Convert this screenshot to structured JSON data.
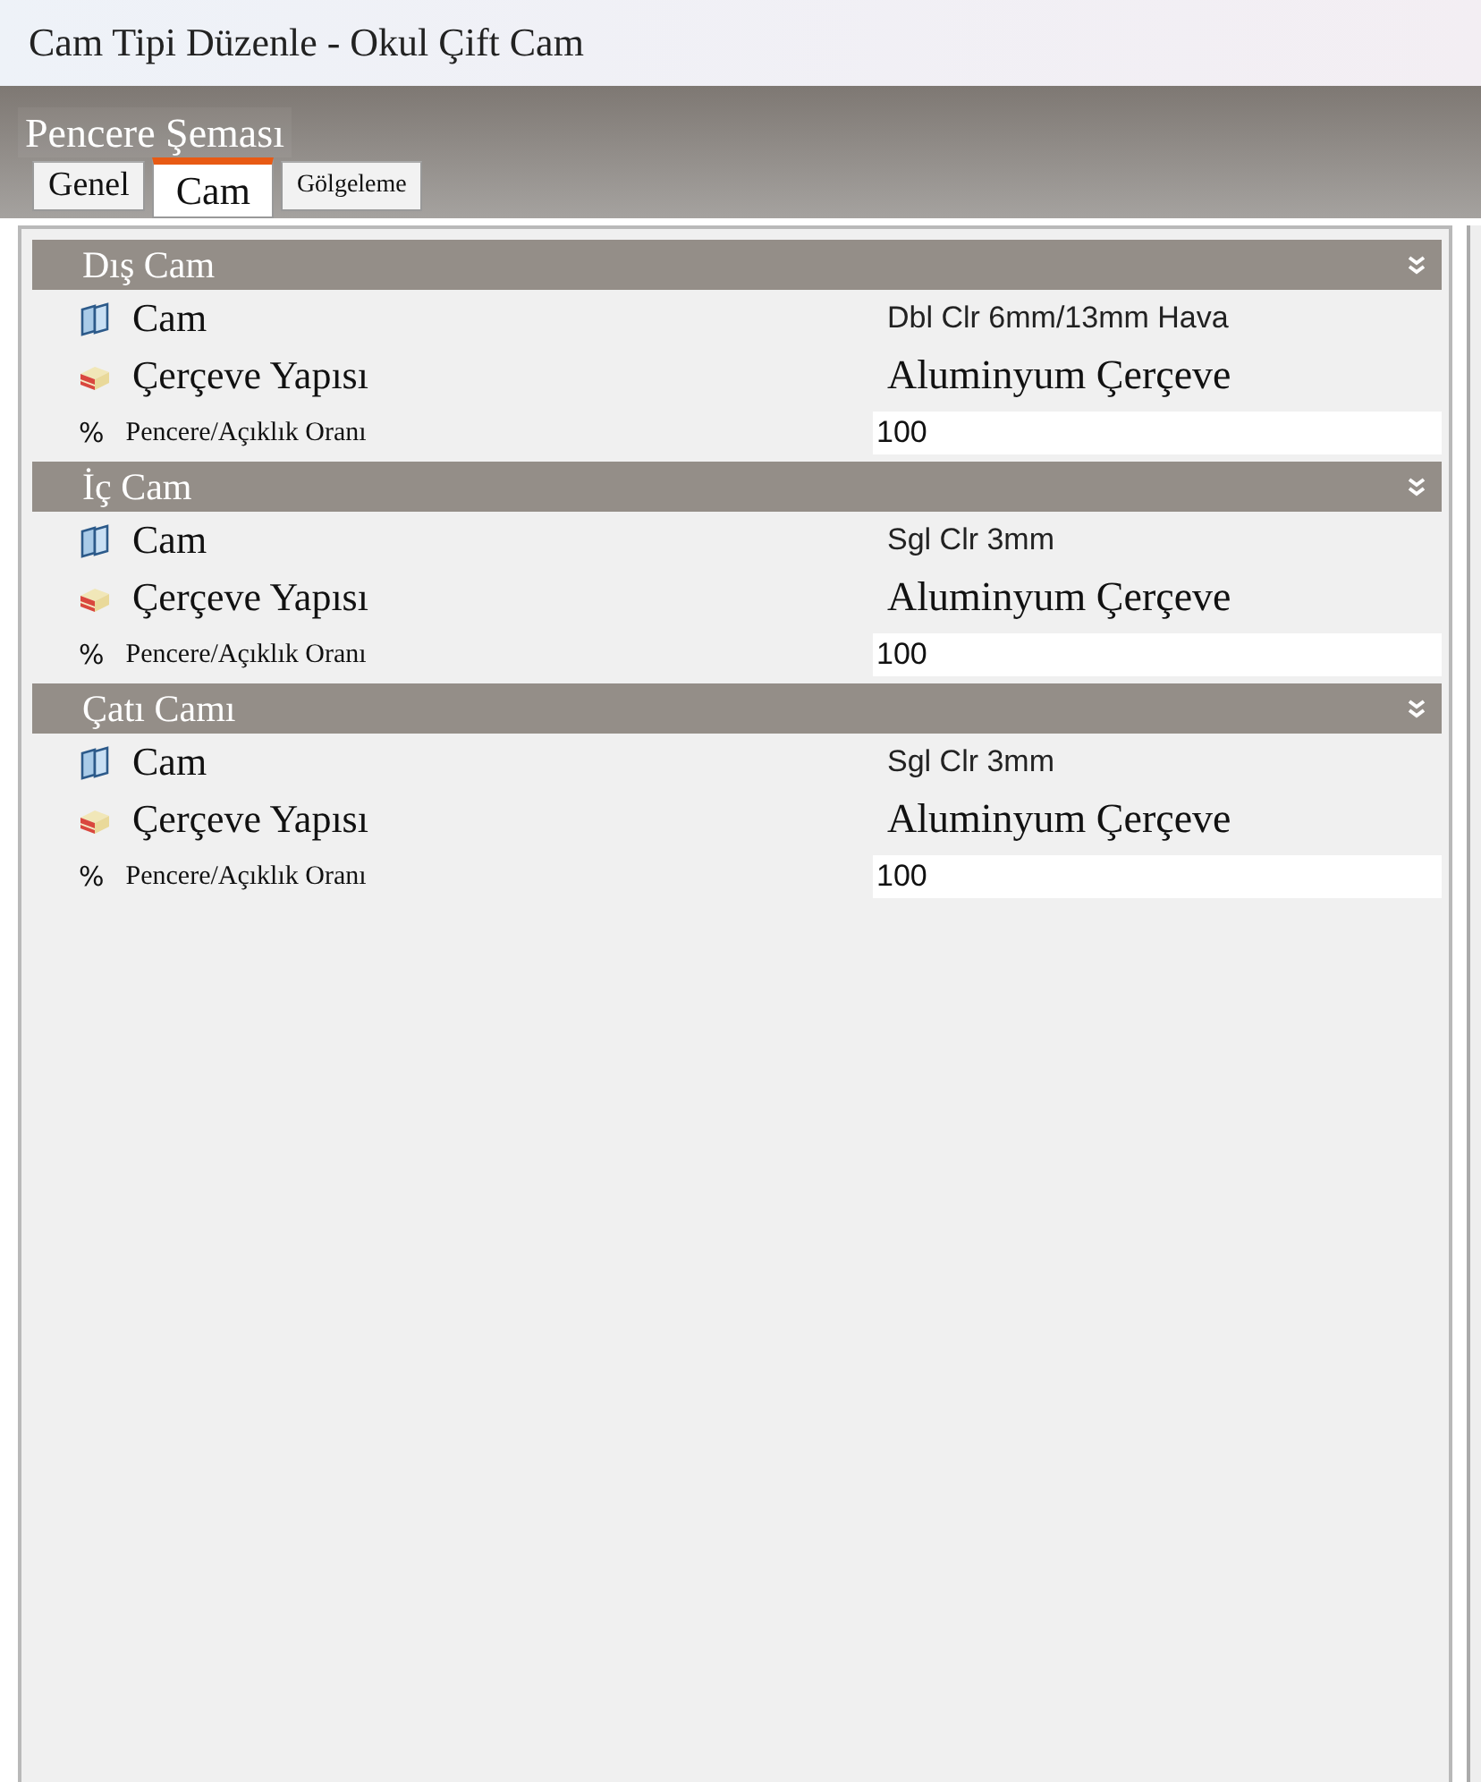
{
  "window": {
    "title": "Cam Tipi Düzenle - Okul Çift Cam"
  },
  "header": {
    "title": "Pencere Şeması"
  },
  "tabs": [
    {
      "label": "Genel",
      "selected": false
    },
    {
      "label": "Cam",
      "selected": true
    },
    {
      "label": "Gölgeleme",
      "selected": false
    }
  ],
  "sections": [
    {
      "title": "Dış Cam",
      "expanded": true,
      "rows": [
        {
          "kind": "glass",
          "label": "Cam",
          "value": "Dbl Clr 6mm/13mm Hava"
        },
        {
          "kind": "frame",
          "label": "Çerçeve Yapısı",
          "value": "Aluminyum Çerçeve"
        },
        {
          "kind": "ratio",
          "symbol": "%",
          "label": "Pencere/Açıklık Oranı",
          "value": "100"
        }
      ]
    },
    {
      "title": "İç Cam",
      "expanded": true,
      "rows": [
        {
          "kind": "glass",
          "label": "Cam",
          "value": "Sgl Clr 3mm"
        },
        {
          "kind": "frame",
          "label": "Çerçeve Yapısı",
          "value": "Aluminyum Çerçeve"
        },
        {
          "kind": "ratio",
          "symbol": "%",
          "label": "Pencere/Açıklık Oranı",
          "value": "100"
        }
      ]
    },
    {
      "title": "Çatı Camı",
      "expanded": true,
      "rows": [
        {
          "kind": "glass",
          "label": "Cam",
          "value": "Sgl Clr 3mm"
        },
        {
          "kind": "frame",
          "label": "Çerçeve Yapısı",
          "value": "Aluminyum Çerçeve"
        },
        {
          "kind": "ratio",
          "symbol": "%",
          "label": "Pencere/Açıklık Oranı",
          "value": "100"
        }
      ]
    }
  ]
}
